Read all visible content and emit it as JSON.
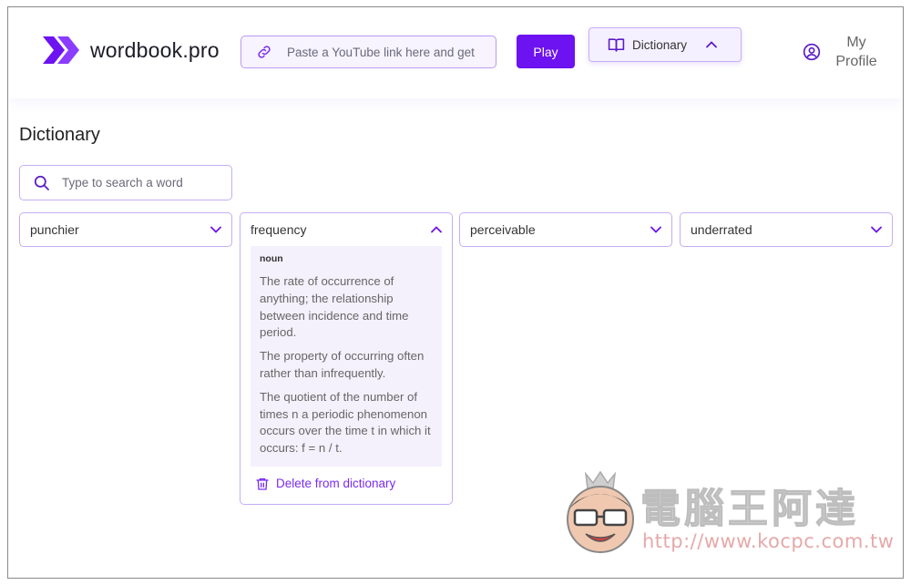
{
  "header": {
    "brand": "wordbook.pro",
    "youtube_placeholder": "Paste a YouTube link here and get",
    "play_label": "Play",
    "dictionary_label": "Dictionary",
    "profile_label": "My Profile"
  },
  "main": {
    "title": "Dictionary",
    "search_placeholder": "Type to search a word",
    "cards": [
      {
        "word": "punchier",
        "expanded": false
      },
      {
        "word": "frequency",
        "expanded": true,
        "part_of_speech": "noun",
        "definitions": [
          "The rate of occurrence of anything; the relationship between incidence and time period.",
          "The property of occurring often rather than infrequently.",
          "The quotient of the number of times n a periodic phenomenon occurs over the time t in which it occurs: f = n / t."
        ],
        "delete_label": "Delete from dictionary"
      },
      {
        "word": "perceivable",
        "expanded": false
      },
      {
        "word": "underrated",
        "expanded": false
      }
    ]
  },
  "watermark": {
    "text": "電腦王阿達",
    "url": "http://www.kocpc.com.tw"
  },
  "colors": {
    "accent": "#6d12f0",
    "border": "#c5adf5",
    "def_background": "#f5f1fc"
  },
  "icons": {
    "logo": "double-chevron-logo-icon",
    "link": "link-icon",
    "book": "book-icon",
    "user": "user-circle-icon",
    "search": "search-icon",
    "trash": "trash-icon"
  }
}
